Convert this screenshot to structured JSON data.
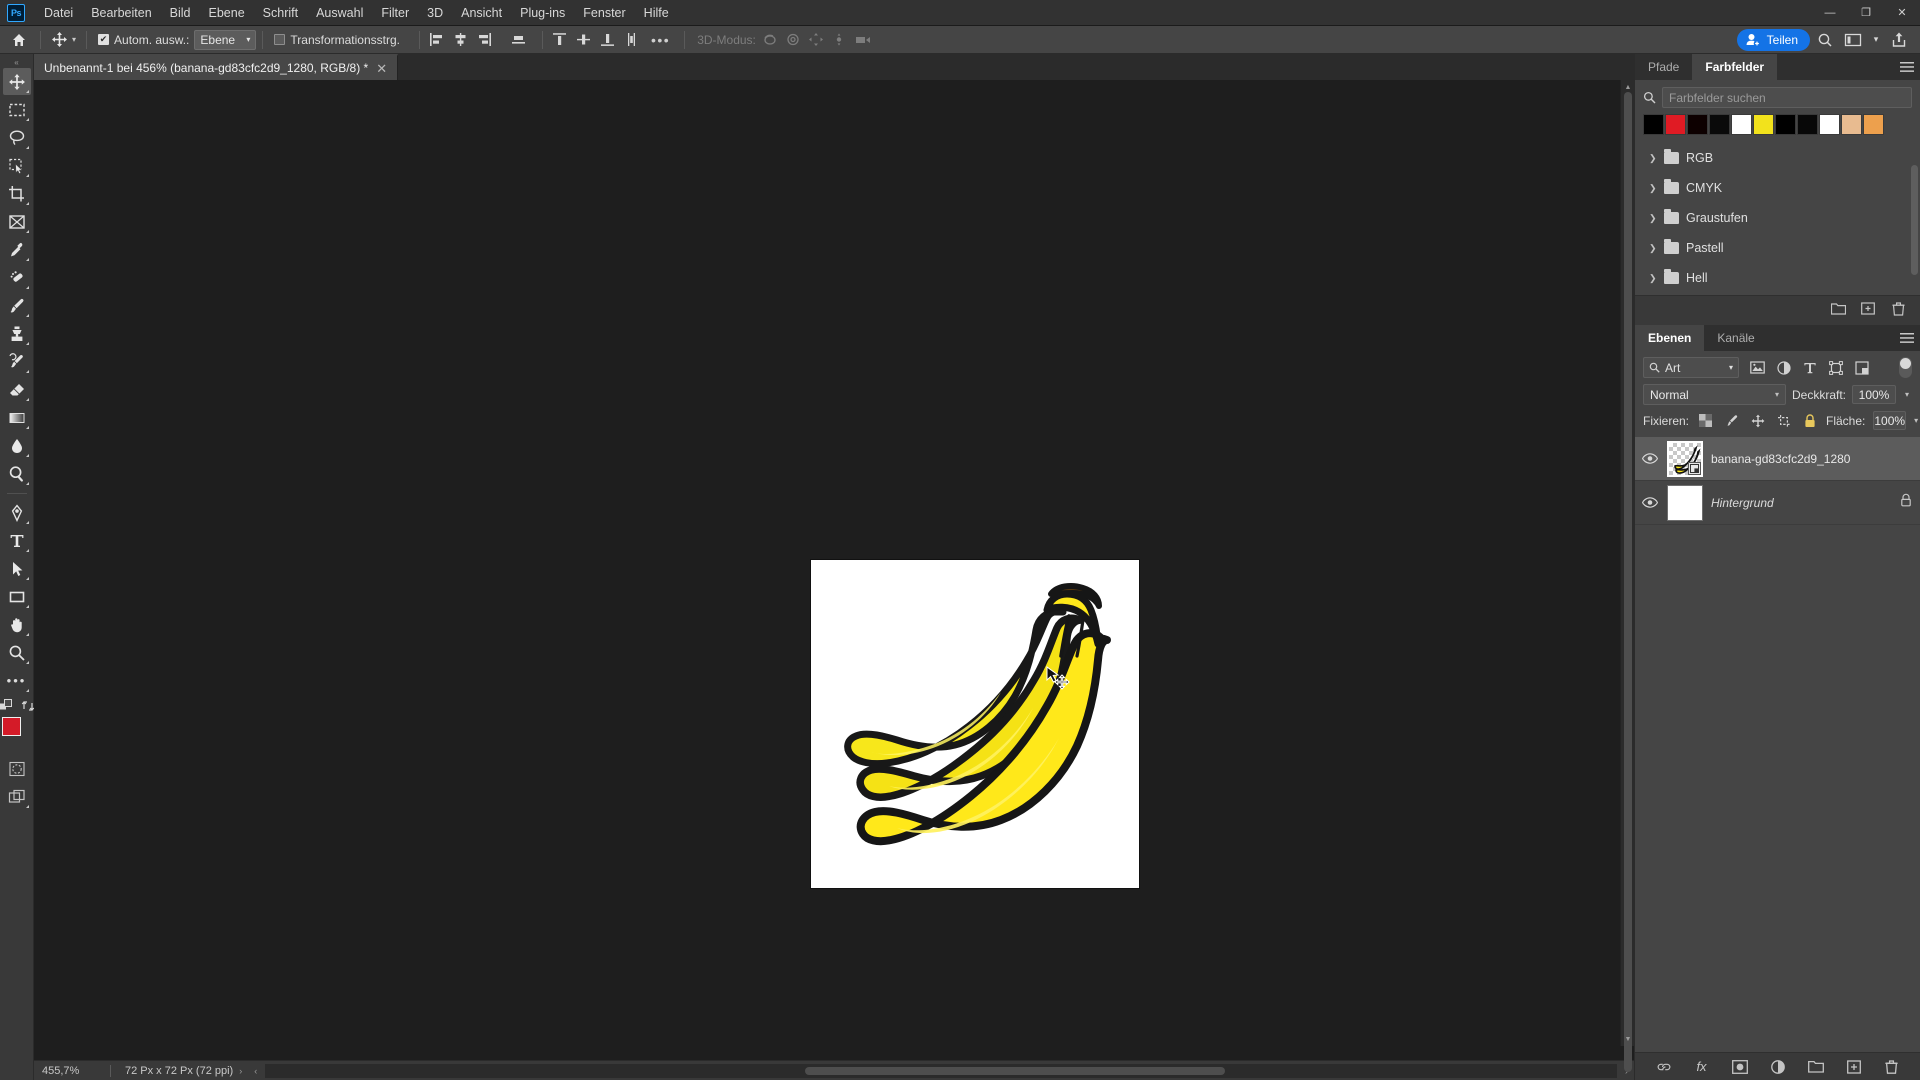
{
  "app": {
    "logo": "Ps",
    "menus": [
      "Datei",
      "Bearbeiten",
      "Bild",
      "Ebene",
      "Schrift",
      "Auswahl",
      "Filter",
      "3D",
      "Ansicht",
      "Plug-ins",
      "Fenster",
      "Hilfe"
    ],
    "window_controls": {
      "minimize": "—",
      "maximize": "❐",
      "close": "✕"
    }
  },
  "options_bar": {
    "home_icon": "home-icon",
    "tool_icon": "move-tool-icon",
    "auto_select_label": "Autom. ausw.:",
    "auto_select_checked": true,
    "auto_select_value": "Ebene",
    "transform_controls_label": "Transformationsstrg.",
    "transform_controls_checked": false,
    "more_label": "•••",
    "mode_3d_label": "3D-Modus:",
    "share_label": "Teilen"
  },
  "toolbar": {
    "tools": [
      {
        "name": "move-tool",
        "glyph": "move",
        "active": true
      },
      {
        "name": "marquee-tool",
        "glyph": "marquee",
        "active": false
      },
      {
        "name": "lasso-tool",
        "glyph": "lasso",
        "active": false
      },
      {
        "name": "quick-selection-tool",
        "glyph": "quickselect",
        "active": false
      },
      {
        "name": "crop-tool",
        "glyph": "crop",
        "active": false
      },
      {
        "name": "frame-tool",
        "glyph": "frame",
        "active": false
      },
      {
        "name": "eyedropper-tool",
        "glyph": "eyedropper",
        "active": false
      },
      {
        "name": "healing-brush-tool",
        "glyph": "healing",
        "active": false
      },
      {
        "name": "brush-tool",
        "glyph": "brush",
        "active": false
      },
      {
        "name": "clone-stamp-tool",
        "glyph": "stamp",
        "active": false
      },
      {
        "name": "history-brush-tool",
        "glyph": "historybrush",
        "active": false
      },
      {
        "name": "eraser-tool",
        "glyph": "eraser",
        "active": false
      },
      {
        "name": "gradient-tool",
        "glyph": "gradient",
        "active": false
      },
      {
        "name": "blur-tool",
        "glyph": "blur",
        "active": false
      },
      {
        "name": "dodge-tool",
        "glyph": "dodge",
        "active": false
      },
      {
        "name": "pen-tool",
        "glyph": "pen",
        "active": false
      },
      {
        "name": "type-tool",
        "glyph": "type",
        "active": false
      },
      {
        "name": "path-selection-tool",
        "glyph": "pathselect",
        "active": false
      },
      {
        "name": "rectangle-tool",
        "glyph": "rectangle",
        "active": false
      },
      {
        "name": "hand-tool",
        "glyph": "hand",
        "active": false
      },
      {
        "name": "zoom-tool",
        "glyph": "zoom",
        "active": false
      },
      {
        "name": "edit-toolbar",
        "glyph": "dots",
        "active": false
      }
    ],
    "foreground_color": "#d41b28",
    "background_color": "#000000",
    "swap_icon": "swap-colors-icon",
    "default_colors_icon": "default-colors-icon",
    "quick_mask_icon": "quick-mask-icon",
    "screen_mode_icon": "screen-mode-icon"
  },
  "document": {
    "tab_title": "Unbenannt-1 bei 456% (banana-gd83cfc2d9_1280, RGB/8) *",
    "close_glyph": "✕"
  },
  "status_bar": {
    "zoom": "455,7%",
    "doc_info": "72 Px x 72 Px (72 ppi)",
    "expand_glyph": "›",
    "collapse_glyph": "‹"
  },
  "swatches_panel": {
    "tabs": [
      {
        "label": "Pfade",
        "active": false
      },
      {
        "label": "Farbfelder",
        "active": true
      }
    ],
    "menu_icon": "panel-menu-icon",
    "search_placeholder": "Farbfelder suchen",
    "search_value": "",
    "search_icon": "search-icon",
    "swatches": [
      "#000000",
      "#e01b24",
      "#0d0000",
      "#0a0a0a",
      "#ffffff",
      "#f2e21c",
      "#000000",
      "#080808",
      "#ffffff",
      "#e8bb90",
      "#eda04d"
    ],
    "groups": [
      {
        "label": "RGB"
      },
      {
        "label": "CMYK"
      },
      {
        "label": "Graustufen"
      },
      {
        "label": "Pastell"
      },
      {
        "label": "Hell"
      }
    ],
    "footer_icons": [
      "new-group-icon",
      "new-swatch-icon",
      "delete-swatch-icon"
    ]
  },
  "layers_panel": {
    "tabs": [
      {
        "label": "Ebenen",
        "active": true
      },
      {
        "label": "Kanäle",
        "active": false
      }
    ],
    "menu_icon": "panel-menu-icon",
    "filter_kind_label": "Art",
    "filter_icons": [
      "filter-pixel-icon",
      "filter-adjustment-icon",
      "filter-type-icon",
      "filter-shape-icon",
      "filter-smart-object-icon"
    ],
    "blend_mode": "Normal",
    "opacity_label": "Deckkraft:",
    "opacity_value": "100%",
    "lock_label": "Fixieren:",
    "lock_icons": [
      "lock-transparency-icon",
      "lock-image-icon",
      "lock-position-icon",
      "lock-artboard-icon",
      "lock-all-icon"
    ],
    "fill_label": "Fläche:",
    "fill_value": "100%",
    "layers": [
      {
        "name": "banana-gd83cfc2d9_1280",
        "visible": true,
        "selected": true,
        "locked": false,
        "smart_object": true,
        "italic": false
      },
      {
        "name": "Hintergrund",
        "visible": true,
        "selected": false,
        "locked": true,
        "smart_object": false,
        "italic": true
      }
    ],
    "footer_icons": [
      "link-layers-icon",
      "layer-fx-icon",
      "add-mask-icon",
      "adjustment-layer-icon",
      "new-group-icon",
      "new-layer-icon",
      "delete-layer-icon"
    ],
    "fx_label": "fx"
  },
  "canvas": {
    "image_description": "banana",
    "background": "#ffffff",
    "banana_fill": "#f5e215",
    "banana_shade": "#ffe926",
    "banana_outline": "#141414",
    "stem_color": "#5a3a10",
    "cursor_icon": "move-cursor"
  },
  "colors": {
    "accent": "#1473e6",
    "panel_bg": "#454545",
    "chrome_bg": "#393939",
    "canvas_bg": "#1e1e1e"
  }
}
